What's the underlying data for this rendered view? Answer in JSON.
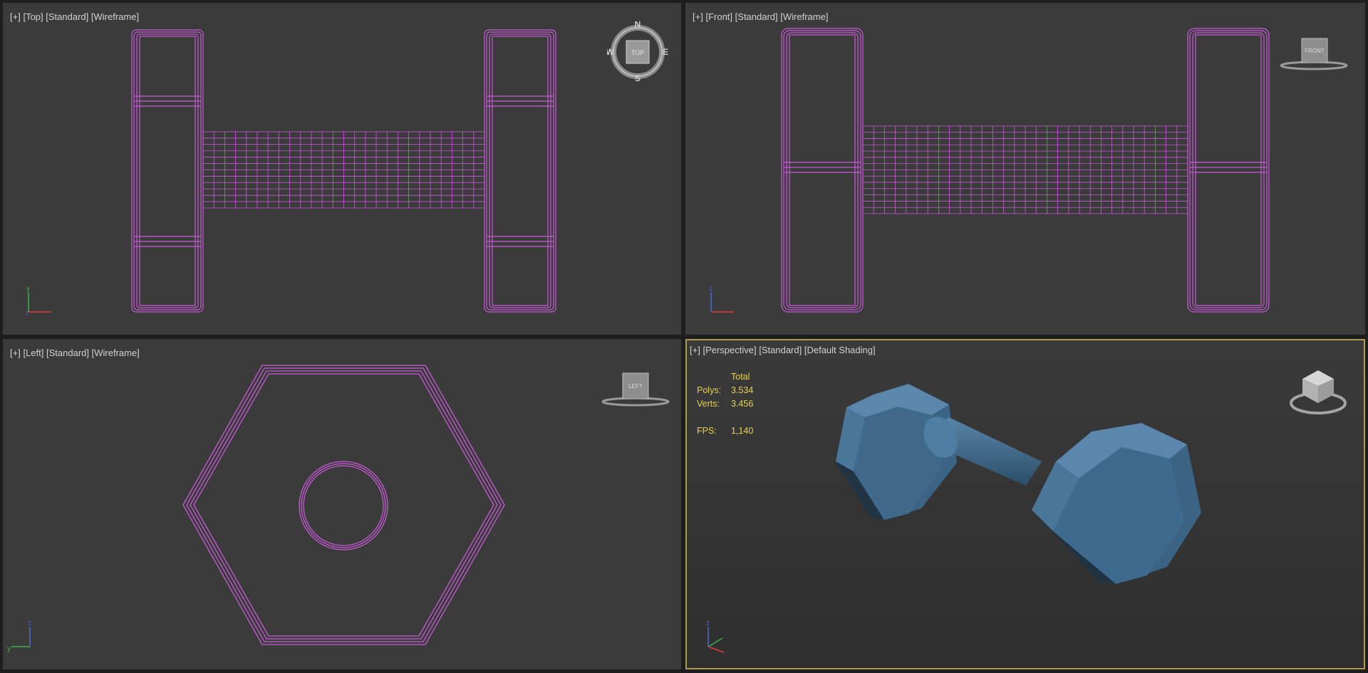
{
  "viewports": {
    "top": {
      "plus": "[+]",
      "view": "[Top]",
      "preset": "[Standard]",
      "style": "[Wireframe]",
      "cube": "TOP",
      "compass": {
        "n": "N",
        "s": "S",
        "e": "E",
        "w": "W"
      }
    },
    "front": {
      "plus": "[+]",
      "view": "[Front]",
      "preset": "[Standard]",
      "style": "[Wireframe]",
      "cube": "FRONT"
    },
    "left": {
      "plus": "[+]",
      "view": "[Left]",
      "preset": "[Standard]",
      "style": "[Wireframe]",
      "cube": "LEFT"
    },
    "perspective": {
      "plus": "[+]",
      "view": "[Perspective]",
      "preset": "[Standard]",
      "style": "[Default Shading]"
    }
  },
  "stats": {
    "total_label": "Total",
    "polys_label": "Polys:",
    "polys_value": "3.534",
    "verts_label": "Verts:",
    "verts_value": "3.456",
    "fps_label": "FPS:",
    "fps_value": "1,140"
  },
  "axes": {
    "top": [
      "y",
      "x"
    ],
    "front": [
      "z",
      "x"
    ],
    "left": [
      "z",
      "y"
    ],
    "perspective": [
      "z",
      "y",
      "x"
    ]
  },
  "colors": {
    "wireframe": "#c85ad8",
    "mesh": "#3c6585",
    "viewport_bg": "#3b3b3b",
    "active_border": "#b39a50",
    "stats_text": "#e8d44a"
  }
}
